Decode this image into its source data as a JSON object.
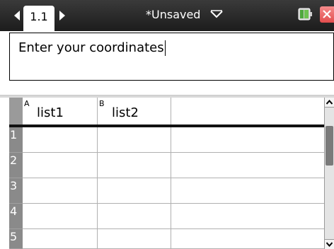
{
  "titlebar": {
    "tab_label": "1.1",
    "document_title": "*Unsaved",
    "icons": {
      "prev": "triangle-left-icon",
      "next": "triangle-right-icon",
      "menu": "chevron-down-icon",
      "battery": "battery-icon",
      "close": "close-icon"
    },
    "close_color": "#e24d4d"
  },
  "text_box": {
    "text": "Enter your coordinates"
  },
  "spreadsheet": {
    "columns": [
      {
        "letter": "A",
        "name": "list1"
      },
      {
        "letter": "B",
        "name": "list2"
      },
      {
        "letter": "",
        "name": ""
      }
    ],
    "rows": [
      "1",
      "2",
      "3",
      "4",
      "5"
    ]
  }
}
